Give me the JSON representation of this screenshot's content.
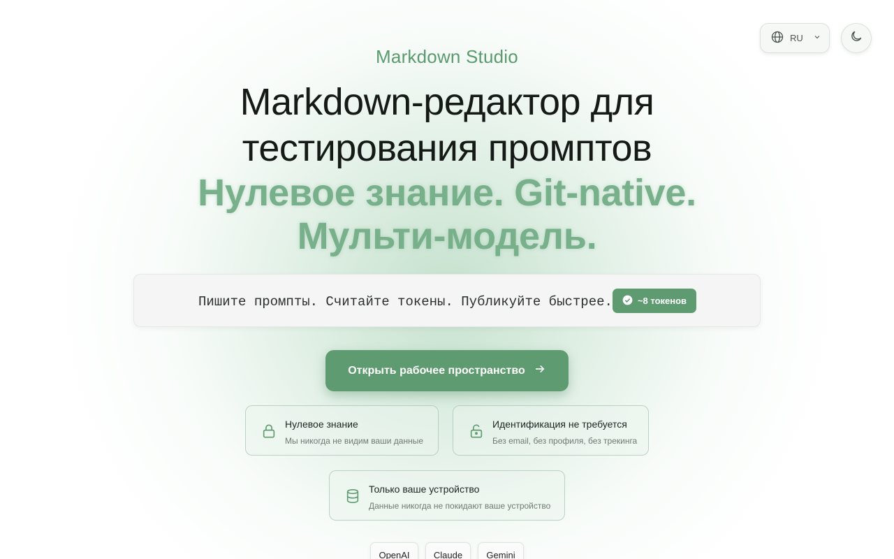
{
  "header": {
    "language_label": "RU",
    "icons": {
      "language": "globe-icon",
      "dropdown": "chevron-down-icon",
      "theme": "moon-icon"
    }
  },
  "hero": {
    "brand": "Markdown Studio",
    "headline_line1": "Markdown-редактор для",
    "headline_line2": "тестирования промптов",
    "tagline_line1": "Нулевое знание. Git-native.",
    "tagline_line2": "Мульти-модель."
  },
  "prompt_demo": {
    "text": "Пишите промпты. Считайте токены. Публикуйте быстрее.",
    "token_badge": "~8 токенов"
  },
  "cta": {
    "label": "Открыть рабочее пространство"
  },
  "features": [
    {
      "title": "Нулевое знание",
      "description": "Мы никогда не видим ваши данные",
      "icon": "lock-icon"
    },
    {
      "title": "Идентификация не требуется",
      "description": "Без email, без профиля, без трекинга",
      "icon": "unlock-icon"
    },
    {
      "title": "Только ваше устройство",
      "description": "Данные никогда не покидают ваше устройство",
      "icon": "database-icon"
    }
  ],
  "models": [
    "OpenAI",
    "Claude",
    "Gemini"
  ],
  "colors": {
    "accent": "#5e9b70",
    "accent_light": "#77b08a",
    "headline": "#151a17"
  }
}
